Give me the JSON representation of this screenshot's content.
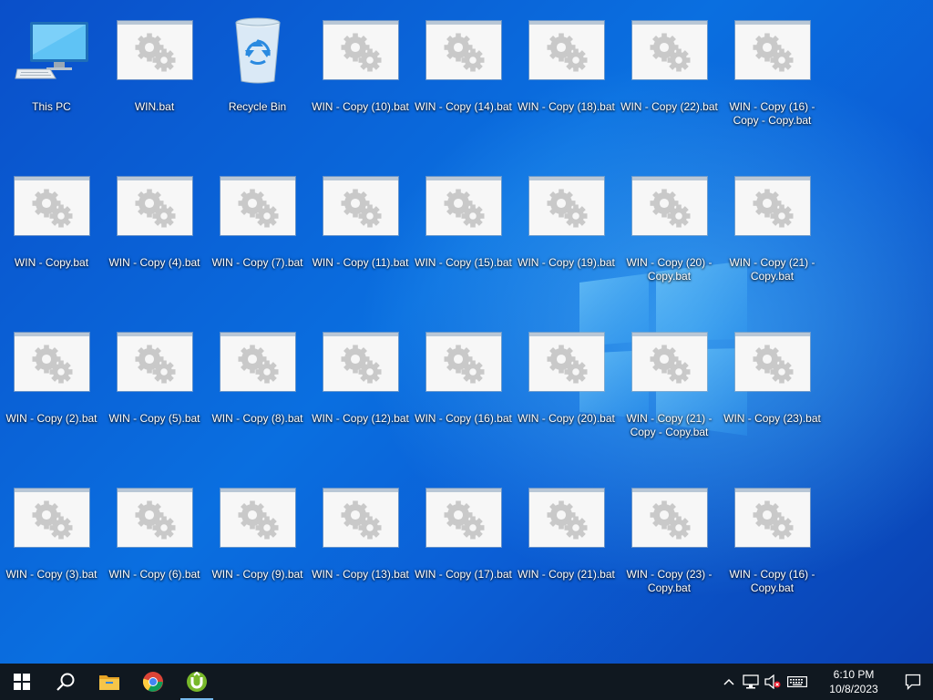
{
  "desktop": {
    "icons": [
      {
        "label": "This PC",
        "type": "pc"
      },
      {
        "label": "WIN.bat",
        "type": "bat"
      },
      {
        "label": "Recycle Bin",
        "type": "recycle"
      },
      {
        "label": "WIN - Copy (10).bat",
        "type": "bat"
      },
      {
        "label": "WIN - Copy (14).bat",
        "type": "bat"
      },
      {
        "label": "WIN - Copy (18).bat",
        "type": "bat"
      },
      {
        "label": "WIN - Copy (22).bat",
        "type": "bat"
      },
      {
        "label": "WIN - Copy (16) - Copy - Copy.bat",
        "type": "bat"
      },
      {
        "label": "WIN - Copy.bat",
        "type": "bat"
      },
      {
        "label": "WIN - Copy (4).bat",
        "type": "bat"
      },
      {
        "label": "WIN - Copy (7).bat",
        "type": "bat"
      },
      {
        "label": "WIN - Copy (11).bat",
        "type": "bat"
      },
      {
        "label": "WIN - Copy (15).bat",
        "type": "bat"
      },
      {
        "label": "WIN - Copy (19).bat",
        "type": "bat"
      },
      {
        "label": "WIN - Copy (20) - Copy.bat",
        "type": "bat"
      },
      {
        "label": "WIN - Copy (21) - Copy.bat",
        "type": "bat"
      },
      {
        "label": "WIN - Copy (2).bat",
        "type": "bat"
      },
      {
        "label": "WIN - Copy (5).bat",
        "type": "bat"
      },
      {
        "label": "WIN - Copy (8).bat",
        "type": "bat"
      },
      {
        "label": "WIN - Copy (12).bat",
        "type": "bat"
      },
      {
        "label": "WIN - Copy (16).bat",
        "type": "bat"
      },
      {
        "label": "WIN - Copy (20).bat",
        "type": "bat"
      },
      {
        "label": "WIN - Copy (21) - Copy - Copy.bat",
        "type": "bat"
      },
      {
        "label": "WIN - Copy (23).bat",
        "type": "bat"
      },
      {
        "label": "WIN - Copy (3).bat",
        "type": "bat"
      },
      {
        "label": "WIN - Copy (6).bat",
        "type": "bat"
      },
      {
        "label": "WIN - Copy (9).bat",
        "type": "bat"
      },
      {
        "label": "WIN - Copy (13).bat",
        "type": "bat"
      },
      {
        "label": "WIN - Copy (17).bat",
        "type": "bat"
      },
      {
        "label": "WIN - Copy (21).bat",
        "type": "bat"
      },
      {
        "label": "WIN - Copy (23) - Copy.bat",
        "type": "bat"
      },
      {
        "label": "WIN - Copy (16) - Copy.bat",
        "type": "bat"
      }
    ]
  },
  "taskbar": {
    "start_icon": "windows-start-icon",
    "search_icon": "search-icon",
    "pinned": [
      {
        "name": "file-explorer-icon"
      },
      {
        "name": "chrome-icon"
      },
      {
        "name": "utorrent-icon",
        "active": true
      }
    ],
    "tray": {
      "icons": [
        "show-hidden-icons-chevron",
        "network-icon",
        "volume-muted-icon",
        "keyboard-icon"
      ],
      "time": "6:10 PM",
      "date": "10/8/2023"
    },
    "notification_icon": "action-center-icon"
  },
  "colors": {
    "accent": "#76b9ed",
    "taskbar_bg": "#101820",
    "desktop_bg": "#0a5fd6"
  }
}
